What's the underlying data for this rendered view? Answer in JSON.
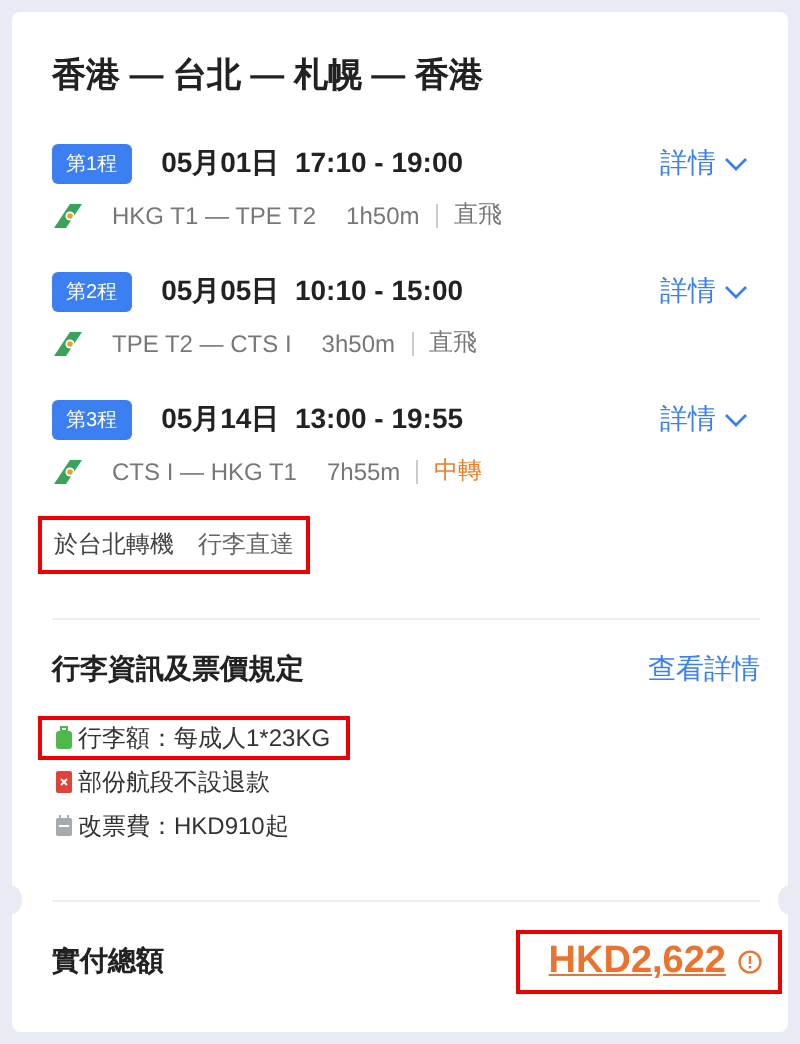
{
  "title": "香港 — 台北 — 札幌 — 香港",
  "legs": [
    {
      "tag": "第1程",
      "time": "05月01日  17:10 - 19:00",
      "route": "HKG T1 — TPE T2",
      "duration": "1h50m",
      "stop": "直飛",
      "transfer": false,
      "details": "詳情"
    },
    {
      "tag": "第2程",
      "time": "05月05日  10:10 - 15:00",
      "route": "TPE T2 — CTS I",
      "duration": "3h50m",
      "stop": "直飛",
      "transfer": false,
      "details": "詳情"
    },
    {
      "tag": "第3程",
      "time": "05月14日  13:00 - 19:55",
      "route": "CTS I — HKG T1",
      "duration": "7h55m",
      "stop": "中轉",
      "transfer": true,
      "details": "詳情"
    }
  ],
  "transfer_note": {
    "texts": [
      "於台北轉機",
      "行李直達"
    ],
    "highlighted": true
  },
  "rules": {
    "title": "行李資訊及票價規定",
    "link": "查看詳情",
    "items": [
      {
        "kind": "baggage",
        "text": "行李額：每成人1*23KG",
        "highlighted": true
      },
      {
        "kind": "refund",
        "text": "部份航段不設退款",
        "highlighted": false
      },
      {
        "kind": "change",
        "text": "改票費：HKD910起",
        "highlighted": false
      }
    ]
  },
  "total": {
    "label": "實付總額",
    "amount": "HKD2,622",
    "highlighted": true
  }
}
